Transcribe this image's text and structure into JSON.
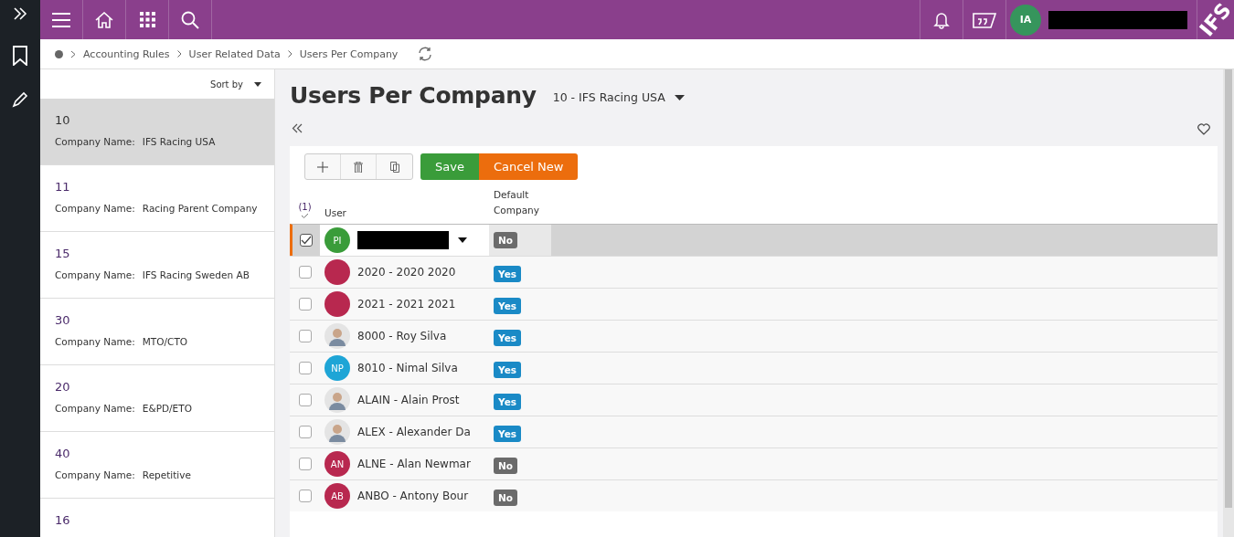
{
  "topbar": {
    "user_initials": "IA",
    "logo": "IFS"
  },
  "breadcrumb": {
    "items": [
      "Accounting Rules",
      "User Related Data",
      "Users Per Company"
    ]
  },
  "list": {
    "sort_label": "Sort by",
    "items": [
      {
        "id": "10",
        "label": "Company Name:",
        "value": "IFS Racing USA",
        "selected": true
      },
      {
        "id": "11",
        "label": "Company Name:",
        "value": "Racing Parent Company",
        "selected": false
      },
      {
        "id": "15",
        "label": "Company Name:",
        "value": "IFS Racing Sweden AB",
        "selected": false
      },
      {
        "id": "30",
        "label": "Company Name:",
        "value": "MTO/CTO",
        "selected": false
      },
      {
        "id": "20",
        "label": "Company Name:",
        "value": "E&PD/ETO",
        "selected": false
      },
      {
        "id": "40",
        "label": "Company Name:",
        "value": "Repetitive",
        "selected": false
      },
      {
        "id": "16",
        "selected": false
      }
    ]
  },
  "page": {
    "title": "Users Per Company",
    "company": "10 - IFS Racing USA"
  },
  "toolbar": {
    "save": "Save",
    "cancel": "Cancel New"
  },
  "table": {
    "selected_count": "(1)",
    "columns": [
      "User",
      "Default\nCompany"
    ],
    "rows": [
      {
        "kind": "initials",
        "initials": "PI",
        "color": "#3a9c3a",
        "selected": true,
        "default": "No",
        "checked": true
      },
      {
        "kind": "initials",
        "color": "#b8284f",
        "user": "2020 - 2020 2020",
        "selected": false,
        "default": "Yes",
        "checked": false
      },
      {
        "kind": "initials",
        "color": "#b8284f",
        "user": "2021 - 2021 2021",
        "selected": false,
        "default": "Yes",
        "checked": false
      },
      {
        "kind": "photo",
        "user": "8000 - Roy Silva",
        "selected": false,
        "default": "Yes",
        "checked": false
      },
      {
        "kind": "initials",
        "initials": "NP",
        "color": "#1ea5d6",
        "user": "8010 - Nimal Silva",
        "selected": false,
        "default": "Yes",
        "checked": false
      },
      {
        "kind": "photo",
        "user": "ALAIN - Alain Prost",
        "selected": false,
        "default": "Yes",
        "checked": false
      },
      {
        "kind": "photo",
        "user": "ALEX - Alexander Da",
        "selected": false,
        "default": "Yes",
        "checked": false
      },
      {
        "kind": "initials",
        "initials": "AN",
        "color": "#b8284f",
        "user": "ALNE - Alan Newmar",
        "selected": false,
        "default": "No",
        "checked": false
      },
      {
        "kind": "initials",
        "initials": "AB",
        "color": "#b8284f",
        "user": "ANBO - Antony Bour",
        "selected": false,
        "default": "No",
        "checked": false
      }
    ]
  }
}
